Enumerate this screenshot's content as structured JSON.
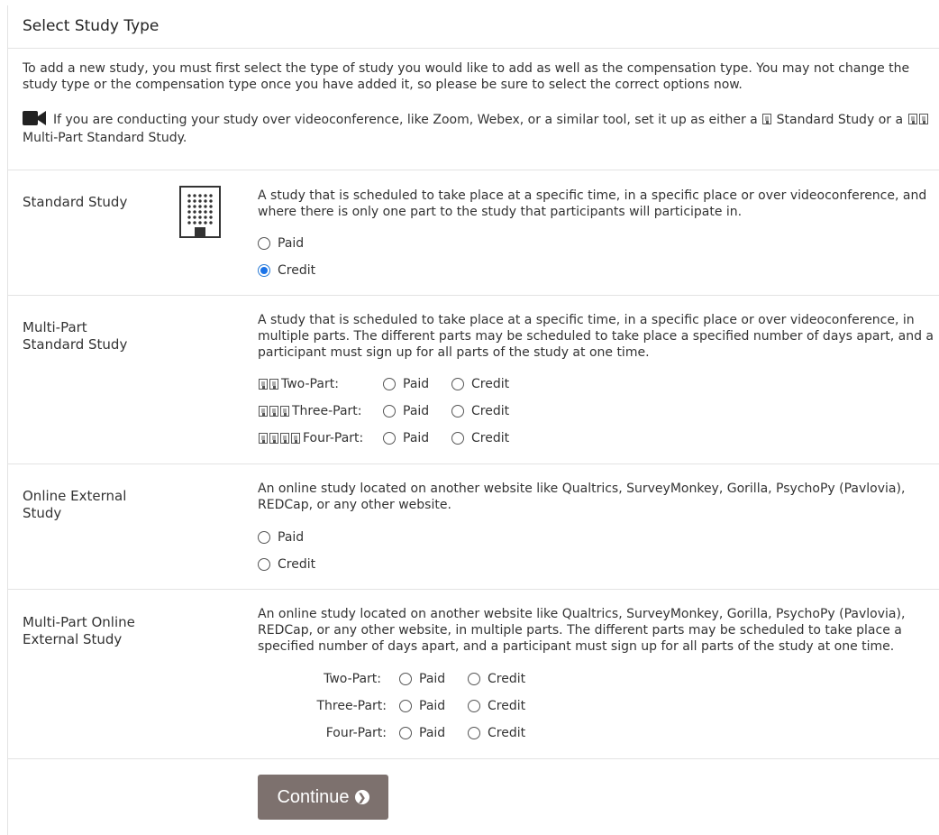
{
  "heading": "Select Study Type",
  "intro": "To add a new study, you must first select the type of study you would like to add as well as the compensation type. You may not change the study type or the compensation type once you have added it, so please be sure to select the correct options now.",
  "video_note": {
    "icon": "video-camera-icon",
    "text_before": "If you are conducting your study over videoconference, like Zoom, Webex, or a similar tool, set it up as either a",
    "standard": "Standard Study",
    "or_a": "or a",
    "multi": "Multi-Part Standard Study."
  },
  "options": {
    "paid": "Paid",
    "credit": "Credit"
  },
  "standard": {
    "label": "Standard Study",
    "icon": "building-icon",
    "desc": "A study that is scheduled to take place at a specific time, in a specific place or over videoconference, and where there is only one part to the study that participants will participate in.",
    "selected": "Credit"
  },
  "multipart": {
    "label_line1": "Multi-Part",
    "label_line2": "Standard Study",
    "desc": "A study that is scheduled to take place at a specific time, in a specific place or over videoconference, in multiple parts. The different parts may be scheduled to take place a specified number of days apart, and a participant must sign up for all parts of the study at one time.",
    "rows": [
      {
        "label": "Two-Part:"
      },
      {
        "label": "Three-Part:"
      },
      {
        "label": "Four-Part:"
      }
    ]
  },
  "online": {
    "label_line1": "Online External",
    "label_line2": "Study",
    "desc": "An online study located on another website like Qualtrics, SurveyMonkey, Gorilla, PsychoPy (Pavlovia), REDCap, or any other website."
  },
  "online_multi": {
    "label_line1": "Multi-Part Online",
    "label_line2": "External Study",
    "desc": "An online study located on another website like Qualtrics, SurveyMonkey, Gorilla, PsychoPy (Pavlovia), REDCap, or any other website, in multiple parts. The different parts may be scheduled to take place a specified number of days apart, and a participant must sign up for all parts of the study at one time.",
    "rows": [
      {
        "label": "Two-Part:"
      },
      {
        "label": "Three-Part:"
      },
      {
        "label": "Four-Part:"
      }
    ]
  },
  "continue_label": "Continue",
  "colors": {
    "button": "#7d716e",
    "radio_selected": "#1a73e8",
    "divider": "#e3e3e3"
  }
}
